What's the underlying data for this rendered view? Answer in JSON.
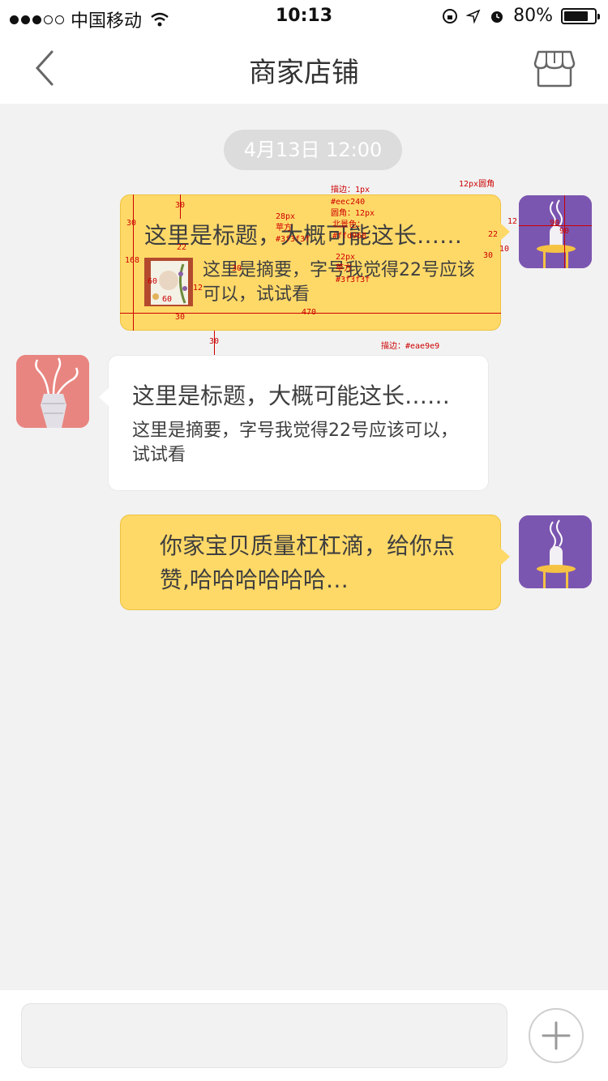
{
  "status_bar": {
    "carrier": "中国移动",
    "time": "10:13",
    "battery": "80%",
    "battery_level": 0.8
  },
  "nav": {
    "title": "商家店铺",
    "back_icon": "chevron-left-icon",
    "store_icon": "store-icon"
  },
  "chat": {
    "timestamp": "4月13日 12:00",
    "messages": [
      {
        "side": "right",
        "type": "card",
        "title": "这里是标题，大概可能这长……",
        "summary": "这里是摘要，字号我觉得22号应该可以，试试看"
      },
      {
        "side": "left",
        "type": "card",
        "title": "这里是标题，大概可能这长……",
        "summary": "这里是摘要，字号我觉得22号应该可以，试试看"
      },
      {
        "side": "right",
        "type": "text",
        "text": "你家宝贝质量杠杠滴，给你点赞,哈哈哈哈哈哈…"
      }
    ]
  },
  "annotations": {
    "stroke_note": "描边：1px",
    "stroke_color": "#eec240",
    "radius_note": "圆角：12px",
    "bg_note": "北景色：",
    "bg_color": "#ffd968",
    "avatar_radius": "12px圆角",
    "title_size": "28px",
    "title_font": "苹方",
    "title_color": "#3f3f3f",
    "summary_size": "22px",
    "summary_font": "苹方",
    "summary_color": "#3f3f3f",
    "white_stroke": "描边：#eae9e9",
    "dims": {
      "pad_top": "30",
      "pad_left": "30",
      "gap": "22",
      "thumb_w": "60",
      "thumb_h": "60",
      "thumb_gap": "12",
      "card_h": "168",
      "card_w": "470",
      "pad_bottom": "30",
      "msg_gap": "30",
      "avatar_gap": "12",
      "tail_h": "22",
      "tail_w": "10",
      "tail_top": "30",
      "avatar_w": "90",
      "avatar_h": "90",
      "summary_line": "30"
    }
  },
  "input": {
    "placeholder": "",
    "plus_icon": "plus-icon"
  }
}
